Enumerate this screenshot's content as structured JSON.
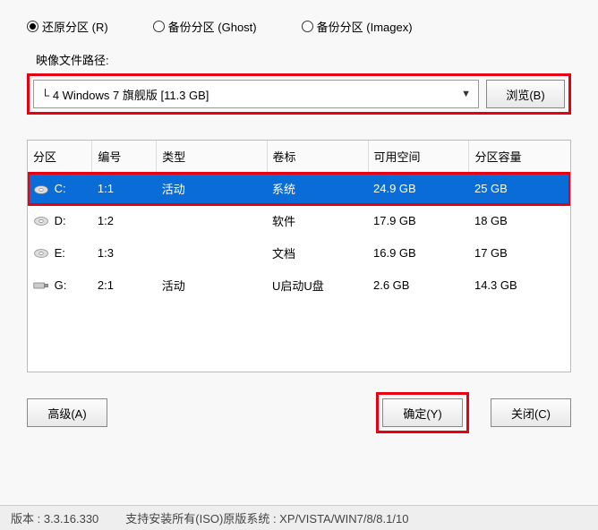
{
  "radios": {
    "restore": "还原分区 (R)",
    "ghost": "备份分区 (Ghost)",
    "imagex": "备份分区 (Imagex)"
  },
  "pathLabel": "映像文件路径:",
  "pathValue": "└ 4 Windows 7 旗舰版 [11.3 GB]",
  "browseLabel": "浏览(B)",
  "headers": {
    "partition": "分区",
    "number": "编号",
    "type": "类型",
    "label": "卷标",
    "free": "可用空间",
    "capacity": "分区容量"
  },
  "rows": [
    {
      "partition": "C:",
      "number": "1:1",
      "type": "活动",
      "label": "系统",
      "free": "24.9 GB",
      "capacity": "25 GB",
      "selected": true
    },
    {
      "partition": "D:",
      "number": "1:2",
      "type": "",
      "label": "软件",
      "free": "17.9 GB",
      "capacity": "18 GB",
      "selected": false
    },
    {
      "partition": "E:",
      "number": "1:3",
      "type": "",
      "label": "文档",
      "free": "16.9 GB",
      "capacity": "17 GB",
      "selected": false
    },
    {
      "partition": "G:",
      "number": "2:1",
      "type": "活动",
      "label": "U启动U盘",
      "free": "2.6 GB",
      "capacity": "14.3 GB",
      "selected": false
    }
  ],
  "buttons": {
    "advanced": "高级(A)",
    "ok": "确定(Y)",
    "close": "关闭(C)"
  },
  "status": {
    "version": "版本 : 3.3.16.330",
    "support": "支持安装所有(ISO)原版系统 : XP/VISTA/WIN7/8/8.1/10"
  }
}
